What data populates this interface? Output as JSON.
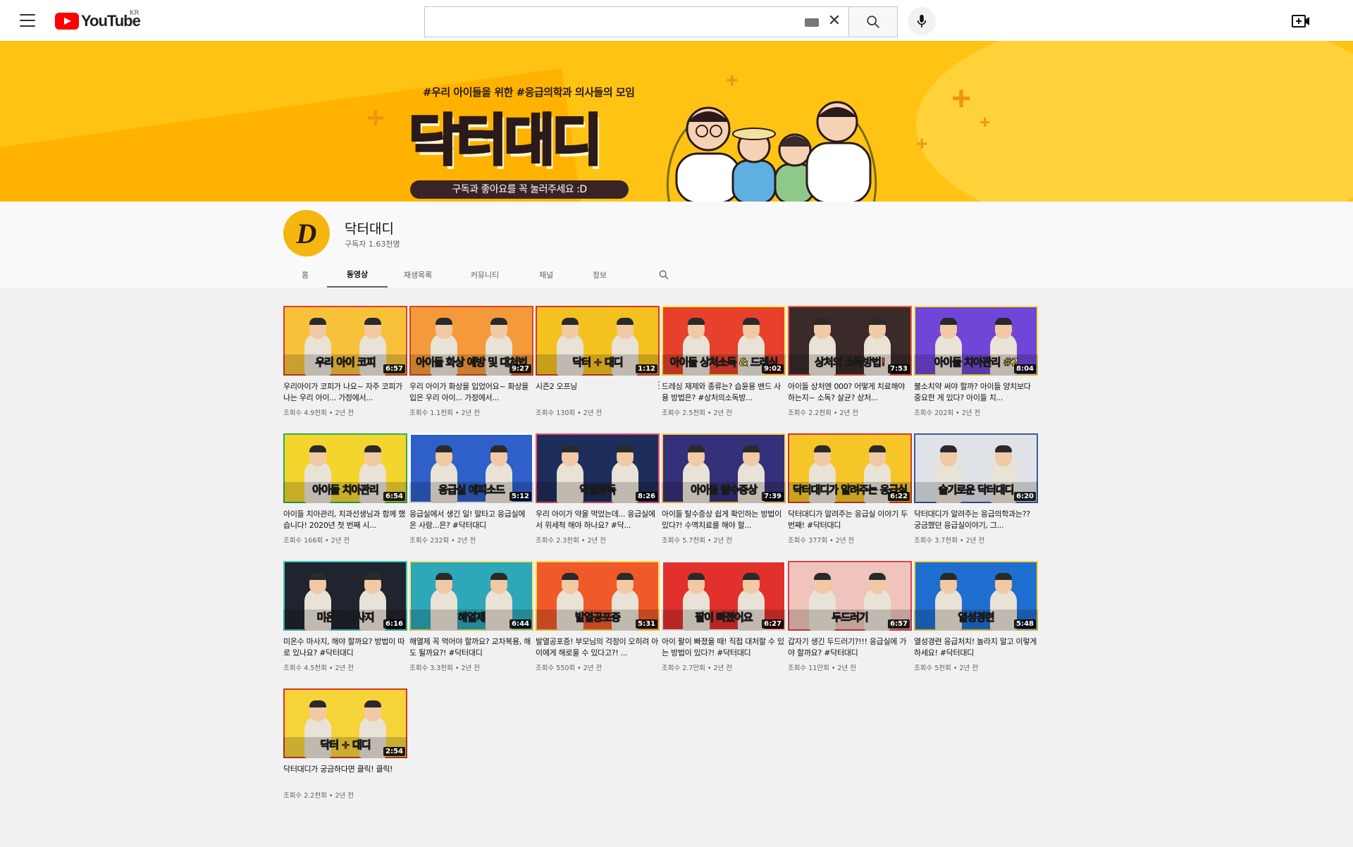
{
  "header": {
    "logo_text": "YouTube",
    "region": "KR",
    "search": {
      "value": "",
      "placeholder": ""
    }
  },
  "banner": {
    "tagline": "#우리 아이들을 위한 #응급의학과 의사들의 모임",
    "title": "닥터대디",
    "pill": "구독과 좋아요를 꼭 눌러주세요 :D"
  },
  "channel": {
    "name": "닥터대디",
    "subscribers": "구독자 1.63천명",
    "avatar_letter": "D"
  },
  "tabs": [
    {
      "label": "홈",
      "active": false
    },
    {
      "label": "동영상",
      "active": true
    },
    {
      "label": "재생목록",
      "active": false
    },
    {
      "label": "커뮤니티",
      "active": false
    },
    {
      "label": "채널",
      "active": false
    },
    {
      "label": "정보",
      "active": false
    }
  ],
  "videos": [
    {
      "title": "우리아이가 코피가 나요~ 자주 코피가 나는 우리 아이... 가정에서...",
      "meta": "조회수 4.9천회 • 2년 전",
      "duration": "6:57",
      "caption": "우리 아이 코피",
      "bg": "#f7c23a",
      "accent": "#e23b2a"
    },
    {
      "title": "우리 아이가 화상을 입었어요~ 화상을 입은 우리 아이... 가정에서...",
      "meta": "조회수 1.1천회 • 2년 전",
      "duration": "9:27",
      "caption": "아이들 화상 예방 및 대처법",
      "bg": "#f59a3a",
      "accent": "#d9481f"
    },
    {
      "title": "시즌2 오프닝",
      "meta": "조회수 130회 • 2년 전",
      "duration": "1:12",
      "caption": "닥터 + 대디",
      "bg": "#f3c21f",
      "accent": "#d63b2a"
    },
    {
      "title": "드레싱 재제와 종류는? 습윤용 밴드 사용 방법은? #상처의소독방...",
      "meta": "조회수 2.5천회 • 2년 전",
      "duration": "9:02",
      "caption": "아이들 상처소독 & 드레싱",
      "bg": "#e7402c",
      "accent": "#fff046"
    },
    {
      "title": "아이들 상처엔 000? 어떻게 치료해야 하는지~ 소독? 살균? 상처...",
      "meta": "조회수 2.2천회 • 2년 전",
      "duration": "7:53",
      "caption": "상처의 소독방법!",
      "bg": "#3a2a2a",
      "accent": "#ff5b3a"
    },
    {
      "title": "불소치약 써야 할까? 아이들 양치보다 중요한 게 있다? 아이들 치...",
      "meta": "조회수 202회 • 2년 전",
      "duration": "8:04",
      "caption": "아이들 치아관리 #2",
      "bg": "#6f46d8",
      "accent": "#ffe23a"
    },
    {
      "title": "아이들 치아관리, 치과선생님과 함께 했습니다! 2020년 첫 번째 시...",
      "meta": "조회수 166회 • 2년 전",
      "duration": "6:54",
      "caption": "아이들 치아관리",
      "bg": "#f4d52e",
      "accent": "#2fb24f"
    },
    {
      "title": "응급실에서 생긴 일! 말타고 응급실에 온 사람...은? #닥터대디",
      "meta": "조회수 232회 • 2년 전",
      "duration": "5:12",
      "caption": "응급실 에피소드",
      "bg": "#2f5fc9",
      "accent": "#ffffff"
    },
    {
      "title": "우리 아이가 약을 먹었는데... 응급실에서 위세척 해야 하나요? #닥...",
      "meta": "조회수 2.3천회 • 2년 전",
      "duration": "8:26",
      "caption": "약물중독",
      "bg": "#1e2e5a",
      "accent": "#ff4f7a"
    },
    {
      "title": "아이들 탈수증상 쉽게 확인하는 방법이 있다?! 수액치료를 해야 할...",
      "meta": "조회수 5.7천회 • 2년 전",
      "duration": "7:39",
      "caption": "아이들 탈수증상",
      "bg": "#35307a",
      "accent": "#ffd34a"
    },
    {
      "title": "닥터대디가 알려주는 응급실 이야기 두 번째! #닥터대디",
      "meta": "조회수 377회 • 2년 전",
      "duration": "6:22",
      "caption": "닥터대디가 알려주는 응급실",
      "bg": "#f6c628",
      "accent": "#d8362a"
    },
    {
      "title": "닥터대디가 알려주는 응급의학과는?? 궁금했던 응급실이야기, 그...",
      "meta": "조회수 3.7천회 • 2년 전",
      "duration": "6:20",
      "caption": "슬기로운 닥터대디",
      "bg": "#dfe3e8",
      "accent": "#3b5aa0"
    },
    {
      "title": "미온수 마사지, 해야 할까요? 방법이 따로 있나요? #닥터대디",
      "meta": "조회수 4.5천회 • 2년 전",
      "duration": "6:16",
      "caption": "미온수 마사지",
      "bg": "#20242e",
      "accent": "#36d0c0"
    },
    {
      "title": "해열제 꼭 먹어야 할까요? 교차복용, 해도 될까요?! #닥터대디",
      "meta": "조회수 3.3천회 • 2년 전",
      "duration": "6:44",
      "caption": "해열제",
      "bg": "#2ea7b8",
      "accent": "#ffe36a"
    },
    {
      "title": "발열공포증! 부모님의 걱정이 오히려 아이에게 해로울 수 있다고?! ...",
      "meta": "조회수 550회 • 2년 전",
      "duration": "5:31",
      "caption": "발열공포증",
      "bg": "#f05a2a",
      "accent": "#ffe046"
    },
    {
      "title": "아이 팔이 빠졌을 때! 직접 대처할 수 있는 방법이 있다?! #닥터대디",
      "meta": "조회수 2.7만회 • 2년 전",
      "duration": "6:27",
      "caption": "팔이 빠졌어요",
      "bg": "#e2302c",
      "accent": "#ffffff"
    },
    {
      "title": "갑자기 생긴 두드러기?!!! 응급실에 가야 할까요? #닥터대디",
      "meta": "조회수 11만회 • 2년 전",
      "duration": "6:57",
      "caption": "두드러기",
      "bg": "#efc4bc",
      "accent": "#e0404a"
    },
    {
      "title": "열성경련 응급처치! 놀라지 말고 이렇게 하세요! #닥터대디",
      "meta": "조회수 5천회 • 2년 전",
      "duration": "5:48",
      "caption": "열성경련",
      "bg": "#1f6fd1",
      "accent": "#ffd23a"
    },
    {
      "title": "닥터대디가 궁금하다면 클릭! 클릭!",
      "meta": "조회수 2.2천회 • 2년 전",
      "duration": "2:54",
      "caption": "닥터 + 대디",
      "bg": "#f7d33a",
      "accent": "#d6362a"
    }
  ]
}
